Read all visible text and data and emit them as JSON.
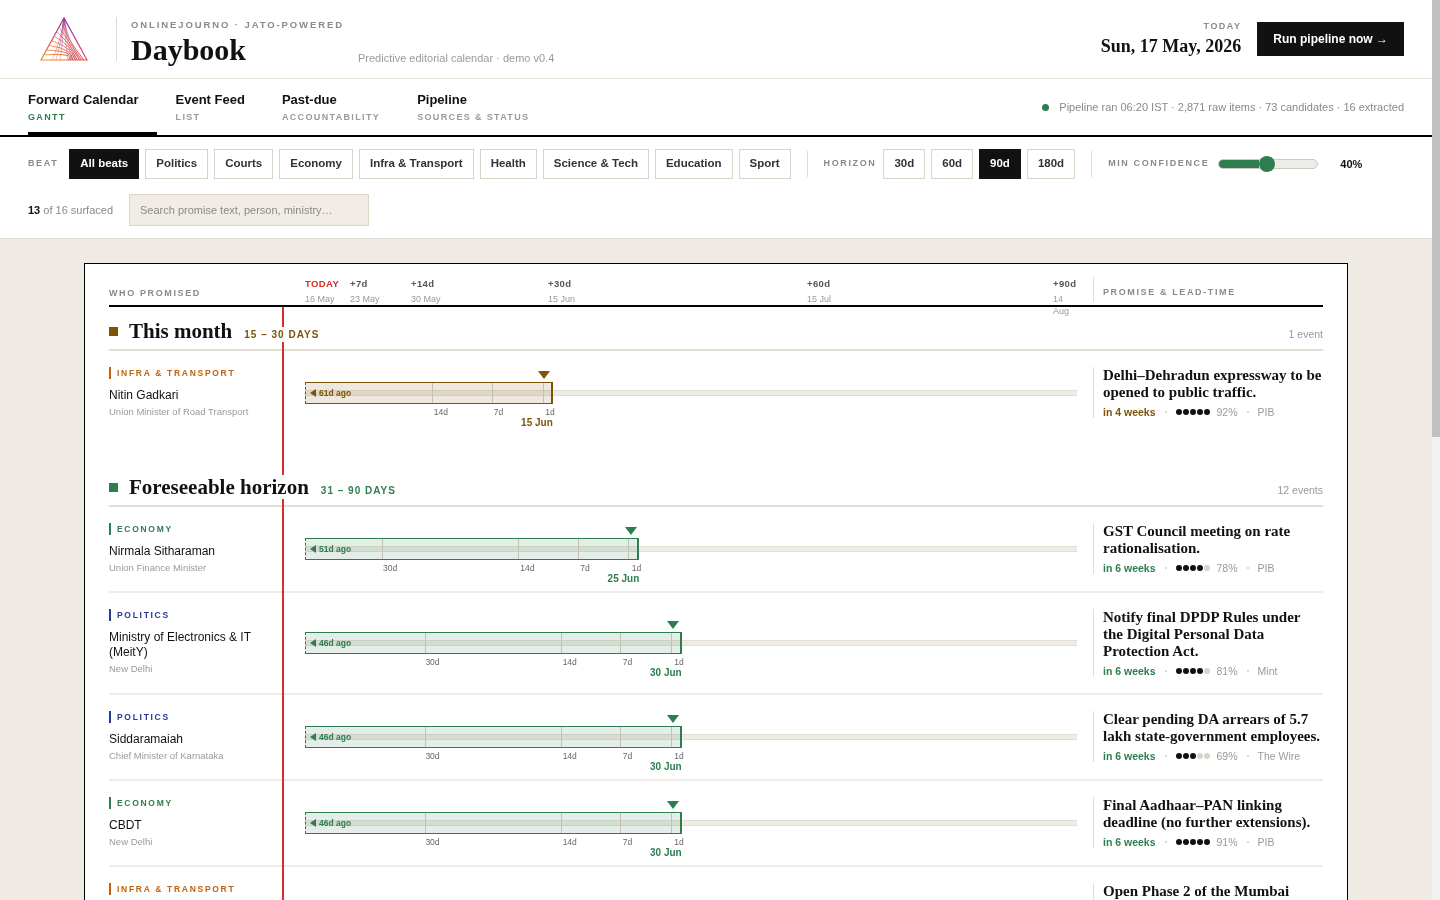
{
  "header": {
    "kicker": "ONLINEJOURNO · JATO-POWERED",
    "title": "Daybook",
    "tagline": "Predictive editorial calendar · demo v0.4",
    "today_label": "TODAY",
    "today_date": "Sun, 17 May, 2026",
    "run_button": "Run pipeline now →"
  },
  "tabs": [
    {
      "label": "Forward Calendar",
      "sublabel": "GANTT",
      "selected": true
    },
    {
      "label": "Event Feed",
      "sublabel": "LIST",
      "selected": false
    },
    {
      "label": "Past-due",
      "sublabel": "ACCOUNTABILITY",
      "selected": false
    },
    {
      "label": "Pipeline",
      "sublabel": "SOURCES & STATUS",
      "selected": false
    }
  ],
  "pipeline_status": {
    "ok": true,
    "text": "Pipeline ran 06:20 IST · 2,871 raw items · 73 candidates · 16 extracted"
  },
  "filters": {
    "beat_label": "BEAT",
    "beats": [
      {
        "label": "All beats",
        "selected": true
      },
      {
        "label": "Politics",
        "selected": false
      },
      {
        "label": "Courts",
        "selected": false
      },
      {
        "label": "Economy",
        "selected": false
      },
      {
        "label": "Infra & Transport",
        "selected": false
      },
      {
        "label": "Health",
        "selected": false
      },
      {
        "label": "Science & Tech",
        "selected": false
      },
      {
        "label": "Education",
        "selected": false
      },
      {
        "label": "Sport",
        "selected": false
      }
    ],
    "horizon_label": "HORIZON",
    "horizons": [
      {
        "label": "30d",
        "selected": false
      },
      {
        "label": "60d",
        "selected": false
      },
      {
        "label": "90d",
        "selected": true
      },
      {
        "label": "180d",
        "selected": false
      }
    ],
    "confidence_label": "MIN CONFIDENCE",
    "confidence": {
      "level": 0.4,
      "reading": "40%"
    },
    "surfaced": "**13** of 16 surfaced",
    "search": {
      "placeholder": "Search promise text, person, ministry…"
    }
  },
  "gantt": {
    "who_heading": "WHO PROMISED",
    "promise_heading": "PROMISE & LEAD-TIME",
    "axis": [
      {
        "kind": "today",
        "label": "TODAY",
        "date": "16 May"
      },
      {
        "kind": "offset",
        "label": "+7d",
        "date": "23 May"
      },
      {
        "kind": "offset",
        "label": "+14d",
        "date": "30 May"
      },
      {
        "kind": "offset",
        "label": "+30d",
        "date": "15 Jun"
      },
      {
        "kind": "offset",
        "label": "+60d",
        "date": "15 Jul"
      },
      {
        "kind": "offset",
        "label": "+90d",
        "date": "14 Aug"
      }
    ],
    "sections": [
      {
        "title": "This month",
        "range": "15 – 30 DAYS",
        "count": "1 event",
        "color": "#7d5406",
        "events": [
          {
            "beat": {
              "label": "INFRA & TRANSPORT",
              "color": "#c0620e"
            },
            "who": "Nitin Gadkari",
            "role": "Union Minister of Road Transport",
            "bar": {
              "level": 0.321,
              "since": "61d ago",
              "ticks": [
                "14d",
                "7d",
                "1d"
              ],
              "deadline": "15 Jun"
            },
            "promise": "Delhi–Dehradun expressway to be opened to public traffic.",
            "due": "in 4 weeks",
            "stars": 5,
            "confidence": "92%",
            "source": "PIB"
          }
        ]
      },
      {
        "title": "Foreseeable horizon",
        "range": "31 – 90 DAYS",
        "count": "12 events",
        "color": "#2e7d4f",
        "events": [
          {
            "beat": {
              "label": "ECONOMY",
              "color": "#2e7d4f"
            },
            "who": "Nirmala Sitharaman",
            "role": "Union Finance Minister",
            "bar": {
              "level": 0.433,
              "since": "51d ago",
              "ticks": [
                "30d",
                "14d",
                "7d",
                "1d"
              ],
              "deadline": "25 Jun"
            },
            "promise": "GST Council meeting on rate rationalisation.",
            "due": "in 6 weeks",
            "stars": 4,
            "confidence": "78%",
            "source": "PIB"
          },
          {
            "beat": {
              "label": "POLITICS",
              "color": "#23399b"
            },
            "who": "Ministry of Electronics & IT (MeitY)",
            "role": "New Delhi",
            "bar": {
              "level": 0.488,
              "since": "46d ago",
              "ticks": [
                "30d",
                "14d",
                "7d",
                "1d"
              ],
              "deadline": "30 Jun"
            },
            "promise": "Notify final DPDP Rules under the Digital Personal Data Protection Act.",
            "due": "in 6 weeks",
            "stars": 4,
            "confidence": "81%",
            "source": "Mint"
          },
          {
            "beat": {
              "label": "POLITICS",
              "color": "#23399b"
            },
            "who": "Siddaramaiah",
            "role": "Chief Minister of Karnataka",
            "bar": {
              "level": 0.488,
              "since": "46d ago",
              "ticks": [
                "30d",
                "14d",
                "7d",
                "1d"
              ],
              "deadline": "30 Jun"
            },
            "promise": "Clear pending DA arrears of 5.7 lakh state-government employees.",
            "due": "in 6 weeks",
            "stars": 3,
            "confidence": "69%",
            "source": "The Wire"
          },
          {
            "beat": {
              "label": "ECONOMY",
              "color": "#2e7d4f"
            },
            "who": "CBDT",
            "role": "New Delhi",
            "bar": {
              "level": 0.488,
              "since": "46d ago",
              "ticks": [
                "30d",
                "14d",
                "7d",
                "1d"
              ],
              "deadline": "30 Jun"
            },
            "promise": "Final Aadhaar–PAN linking deadline (no further extensions).",
            "due": "in 6 weeks",
            "stars": 5,
            "confidence": "91%",
            "source": "PIB"
          },
          {
            "beat": {
              "label": "INFRA & TRANSPORT",
              "color": "#c0620e"
            },
            "promise": "Open Phase 2 of the Mumbai"
          }
        ]
      }
    ]
  }
}
